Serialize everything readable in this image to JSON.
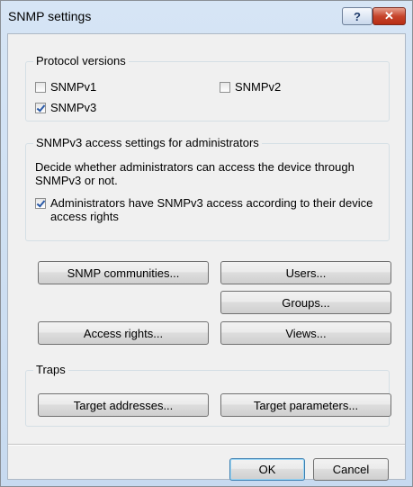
{
  "window": {
    "title": "SNMP settings"
  },
  "titlebar": {
    "help_glyph": "?",
    "close_glyph": "✕"
  },
  "protocol": {
    "label": "Protocol versions",
    "snmpv1": {
      "label": "SNMPv1",
      "checked": false
    },
    "snmpv2": {
      "label": "SNMPv2",
      "checked": false
    },
    "snmpv3": {
      "label": "SNMPv3",
      "checked": true
    }
  },
  "admin": {
    "label": "SNMPv3 access settings for administrators",
    "description": "Decide whether administrators can access the device through SNMPv3 or not.",
    "checkbox_label": "Administrators have SNMPv3 access according to their device access rights",
    "checked": true
  },
  "buttons": {
    "communities": "SNMP communities...",
    "users": "Users...",
    "groups": "Groups...",
    "access_rights": "Access rights...",
    "views": "Views..."
  },
  "traps": {
    "label": "Traps",
    "target_addresses": "Target addresses...",
    "target_parameters": "Target parameters..."
  },
  "footer": {
    "ok": "OK",
    "cancel": "Cancel"
  },
  "colors": {
    "close_button": "#c6452c",
    "frame": "#c7daf0"
  },
  "icons": [
    "help-icon",
    "close-icon",
    "checkbox-checked-icon",
    "checkbox-unchecked-icon"
  ]
}
